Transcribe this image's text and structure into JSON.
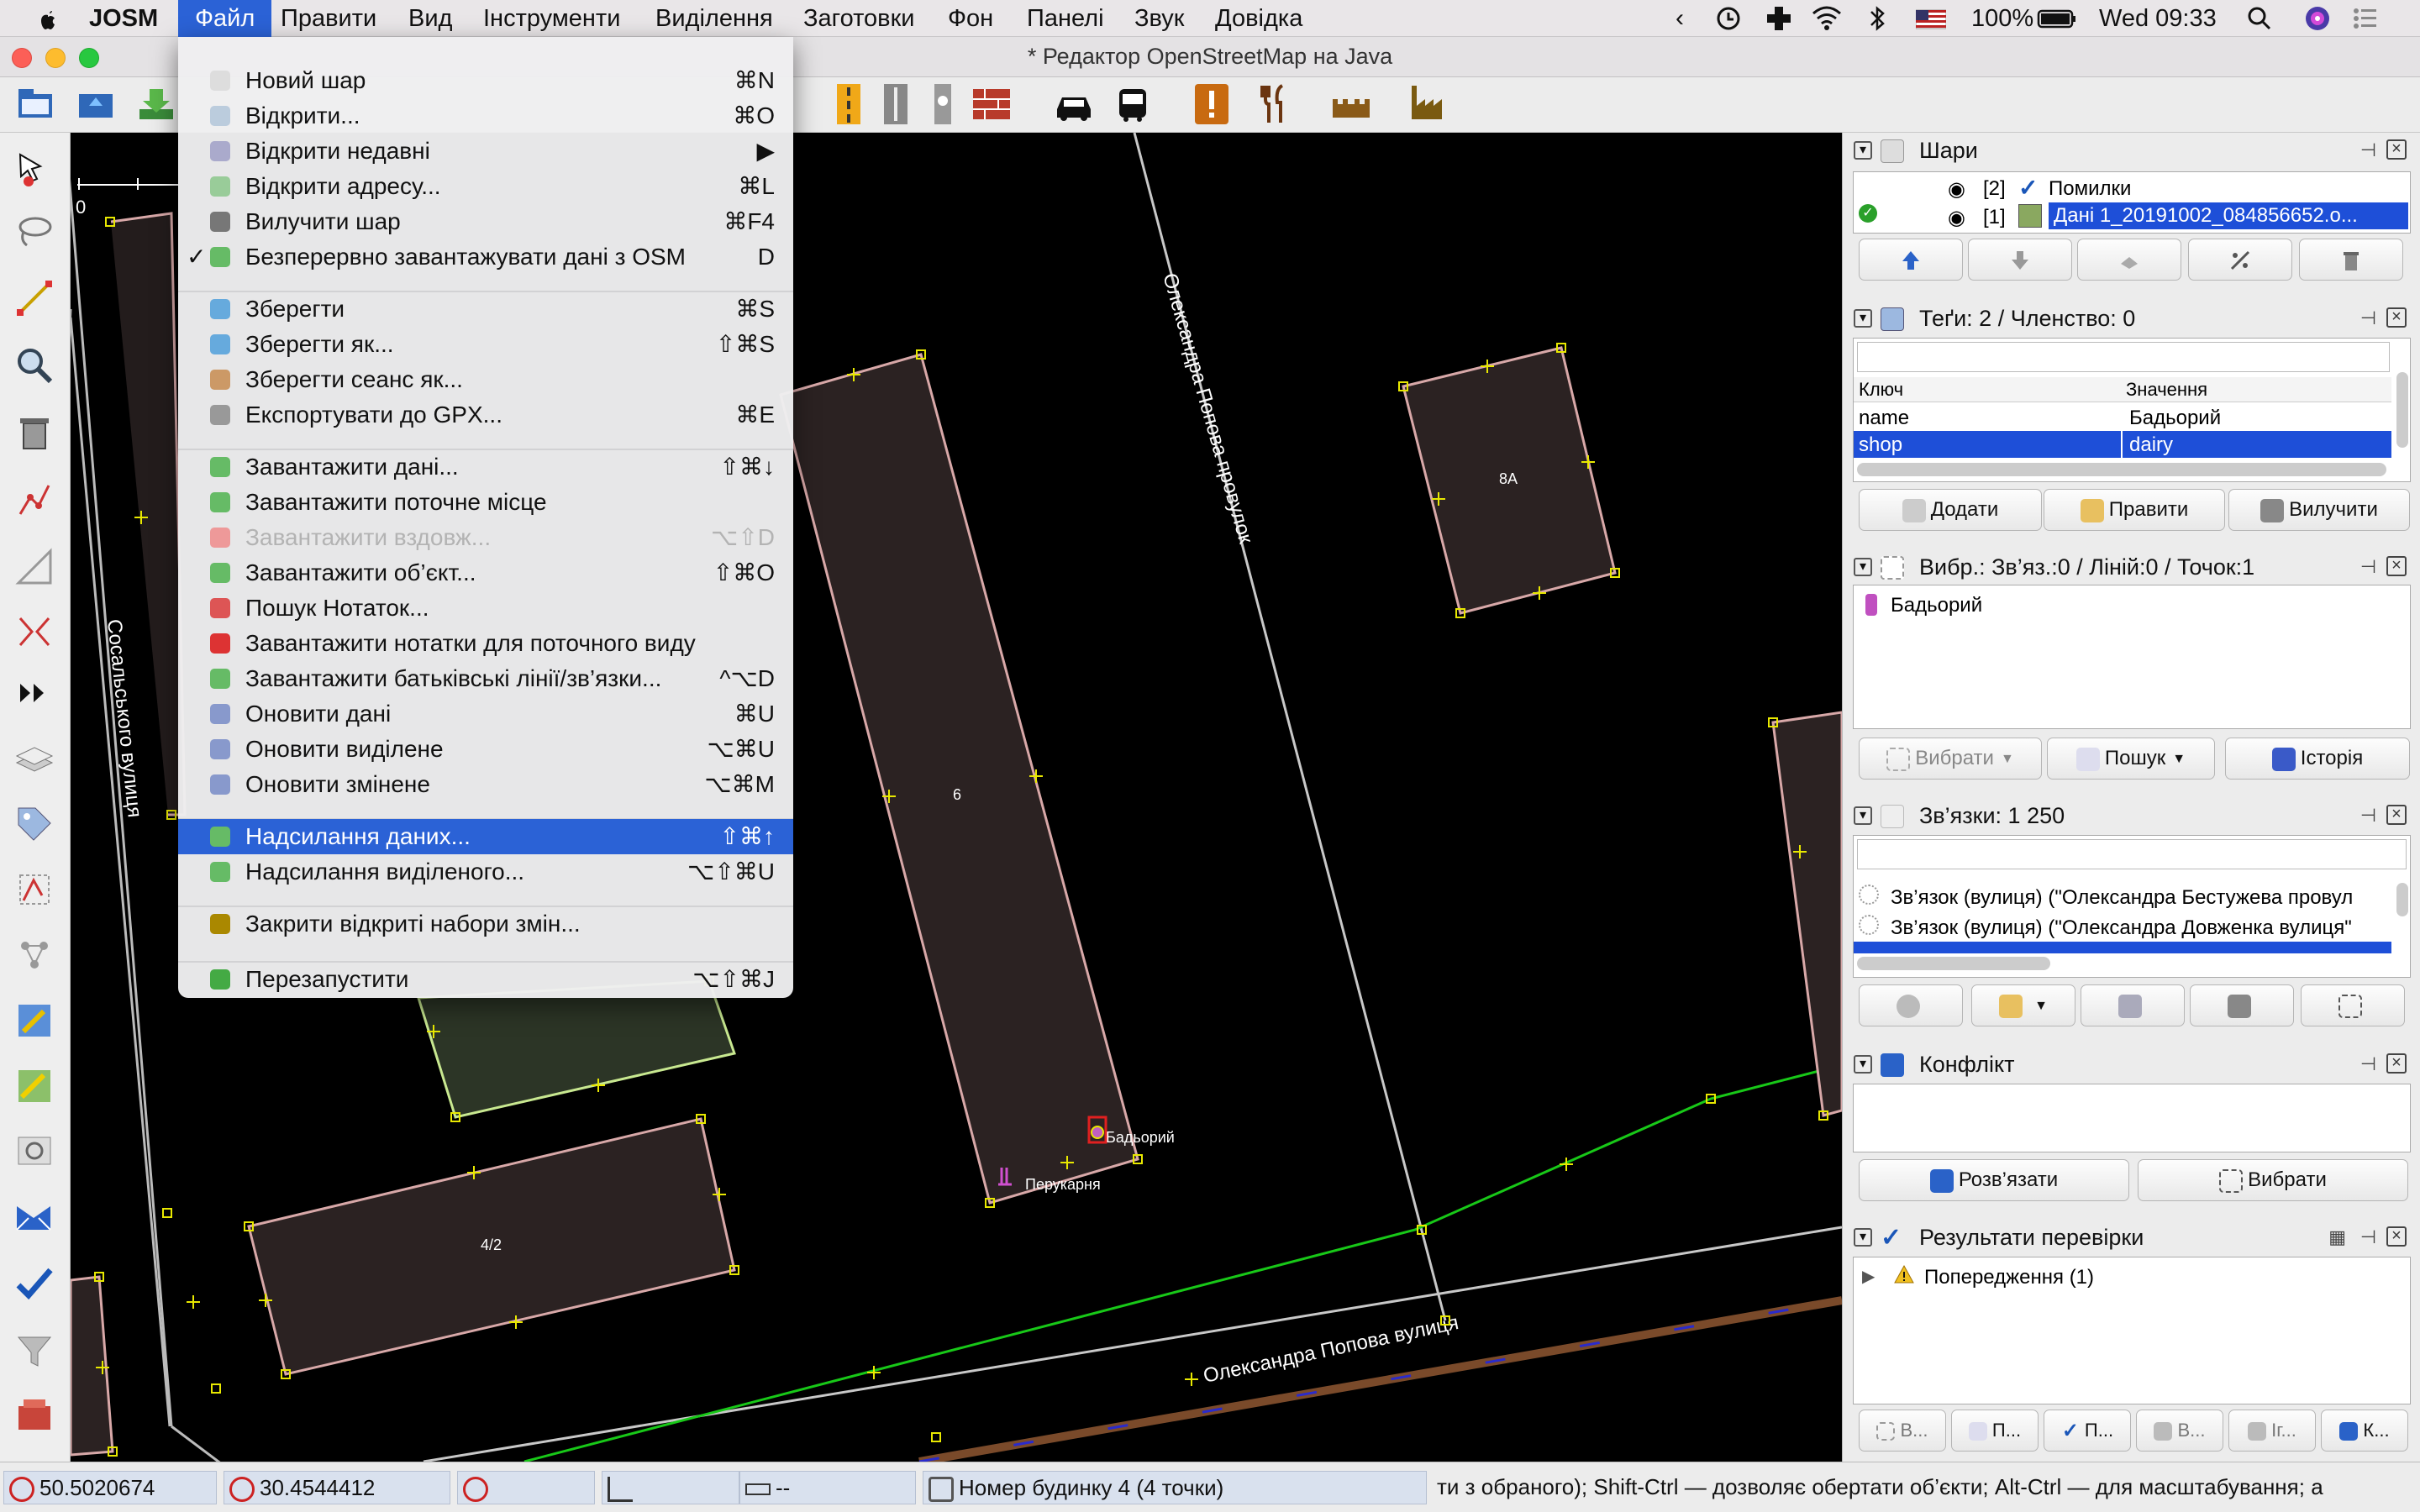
{
  "macos_menubar": {
    "app_name": "JOSM",
    "menus": [
      "Файл",
      "Правити",
      "Вид",
      "Інструменти",
      "Виділення",
      "Заготовки",
      "Фон",
      "Панелі",
      "Звук",
      "Довідка"
    ],
    "active_menu": "Файл",
    "battery": "100%",
    "clock": "Wed 09:33"
  },
  "window": {
    "title": "* Редактор OpenStreetMap на Java"
  },
  "file_menu": {
    "items": [
      {
        "label": "Новий шар",
        "shortcut": "⌘N"
      },
      {
        "label": "Відкрити...",
        "shortcut": "⌘O"
      },
      {
        "label": "Відкрити недавні",
        "shortcut": "▶"
      },
      {
        "label": "Відкрити адресу...",
        "shortcut": "⌘L"
      },
      {
        "label": "Вилучити шар",
        "shortcut": "⌘F4"
      },
      {
        "label": "Безперервно завантажувати дані з OSM",
        "shortcut": "D",
        "checked": true
      },
      {
        "label": "Зберегти",
        "shortcut": "⌘S"
      },
      {
        "label": "Зберегти як...",
        "shortcut": "⇧⌘S"
      },
      {
        "label": "Зберегти сеанс як...",
        "shortcut": ""
      },
      {
        "label": "Експортувати до GPX...",
        "shortcut": "⌘E"
      },
      {
        "label": "Завантажити дані...",
        "shortcut": "⇧⌘↓"
      },
      {
        "label": "Завантажити поточне місце",
        "shortcut": ""
      },
      {
        "label": "Завантажити вздовж...",
        "shortcut": "⌥⇧D",
        "disabled": true
      },
      {
        "label": "Завантажити об’єкт...",
        "shortcut": "⇧⌘O"
      },
      {
        "label": "Пошук Нотаток...",
        "shortcut": ""
      },
      {
        "label": "Завантажити нотатки для поточного виду",
        "shortcut": ""
      },
      {
        "label": "Завантажити батьківські лінії/зв’язки...",
        "shortcut": "^⌥D"
      },
      {
        "label": "Оновити дані",
        "shortcut": "⌘U"
      },
      {
        "label": "Оновити виділене",
        "shortcut": "⌥⌘U"
      },
      {
        "label": "Оновити змінене",
        "shortcut": "⌥⌘M"
      },
      {
        "label": "Надсилання даних...",
        "shortcut": "⇧⌘↑",
        "highlighted": true
      },
      {
        "label": "Надсилання виділеного...",
        "shortcut": "⌥⇧⌘U"
      },
      {
        "label": "Закрити відкриті набори змін...",
        "shortcut": ""
      },
      {
        "label": "Перезапустити",
        "shortcut": "⌥⇧⌘J"
      }
    ]
  },
  "map": {
    "scale_zero": "0",
    "buildings": [
      "6",
      "8А",
      "4/2"
    ],
    "street_labels": [
      "Олександра Попова провулок",
      "Олександра Попова вулиця",
      "Сосальського вулиця"
    ],
    "poi_labels": [
      "Бадьорий",
      "Перукарня"
    ]
  },
  "panels": {
    "layers": {
      "title": "Шари",
      "items": [
        {
          "index": "[2]",
          "name": "Помилки"
        },
        {
          "index": "[1]",
          "name": "Дані 1_20191002_084856652.o..."
        }
      ]
    },
    "tags": {
      "title": "Теґи: 2 / Членство: 0",
      "col_key": "Ключ",
      "col_value": "Значення",
      "rows": [
        {
          "key": "name",
          "value": "Бадьорий"
        },
        {
          "key": "shop",
          "value": "dairy"
        }
      ],
      "btn_add": "Додати",
      "btn_edit": "Правити",
      "btn_delete": "Вилучити"
    },
    "selection": {
      "title": "Вибр.: Зв’яз.:0 / Ліній:0 / Точок:1",
      "items": [
        "Бадьорий"
      ],
      "btn_select": "Вибрати",
      "btn_search": "Пошук",
      "btn_history": "Історія"
    },
    "relations": {
      "title": "Зв’язки: 1 250",
      "items": [
        "Зв’язок (вулиця) (\"Олександра Бестужева провул",
        "Зв’язок (вулиця) (\"Олександра Довженка вулиця\""
      ]
    },
    "conflict": {
      "title": "Конфлікт",
      "btn_resolve": "Розв’язати",
      "btn_select": "Вибрати"
    },
    "validation": {
      "title": "Результати перевірки",
      "items": [
        "Попередження (1)"
      ],
      "buttons": [
        "В...",
        "П...",
        "П...",
        "В...",
        "Іг...",
        "К..."
      ]
    }
  },
  "statusbar": {
    "lat": "50.5020674",
    "lon": "30.4544412",
    "distance": "--",
    "info": "Номер будинку 4 (4 точки)",
    "help": "ти з обраного); Shift-Ctrl — дозволяє обертати об’єкти; Alt-Ctrl — для масштабування; а"
  },
  "colors": {
    "menu_highlight": "#2b62d6",
    "selection_blue": "#1e4fd8",
    "building_fill": "#2b2222",
    "building_outline": "#d8a8a8",
    "node_yellow": "#e8e800"
  }
}
